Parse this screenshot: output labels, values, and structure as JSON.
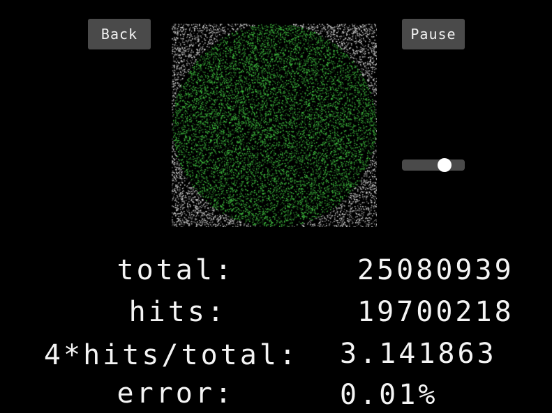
{
  "controls": {
    "back_label": "Back",
    "pause_label": "Pause",
    "speed_slider_value": 0.68
  },
  "simulation": {
    "hit_color": "#3fbf3f",
    "miss_color": "#d8d8d8",
    "background_color": "#000000"
  },
  "stats": {
    "total_label": "total:",
    "total_value": "25080939",
    "hits_label": "hits:",
    "hits_value": "19700218",
    "ratio_label": "4*hits/total:",
    "ratio_value": "3.141863",
    "error_label": "error:",
    "error_value": "0.01%"
  }
}
